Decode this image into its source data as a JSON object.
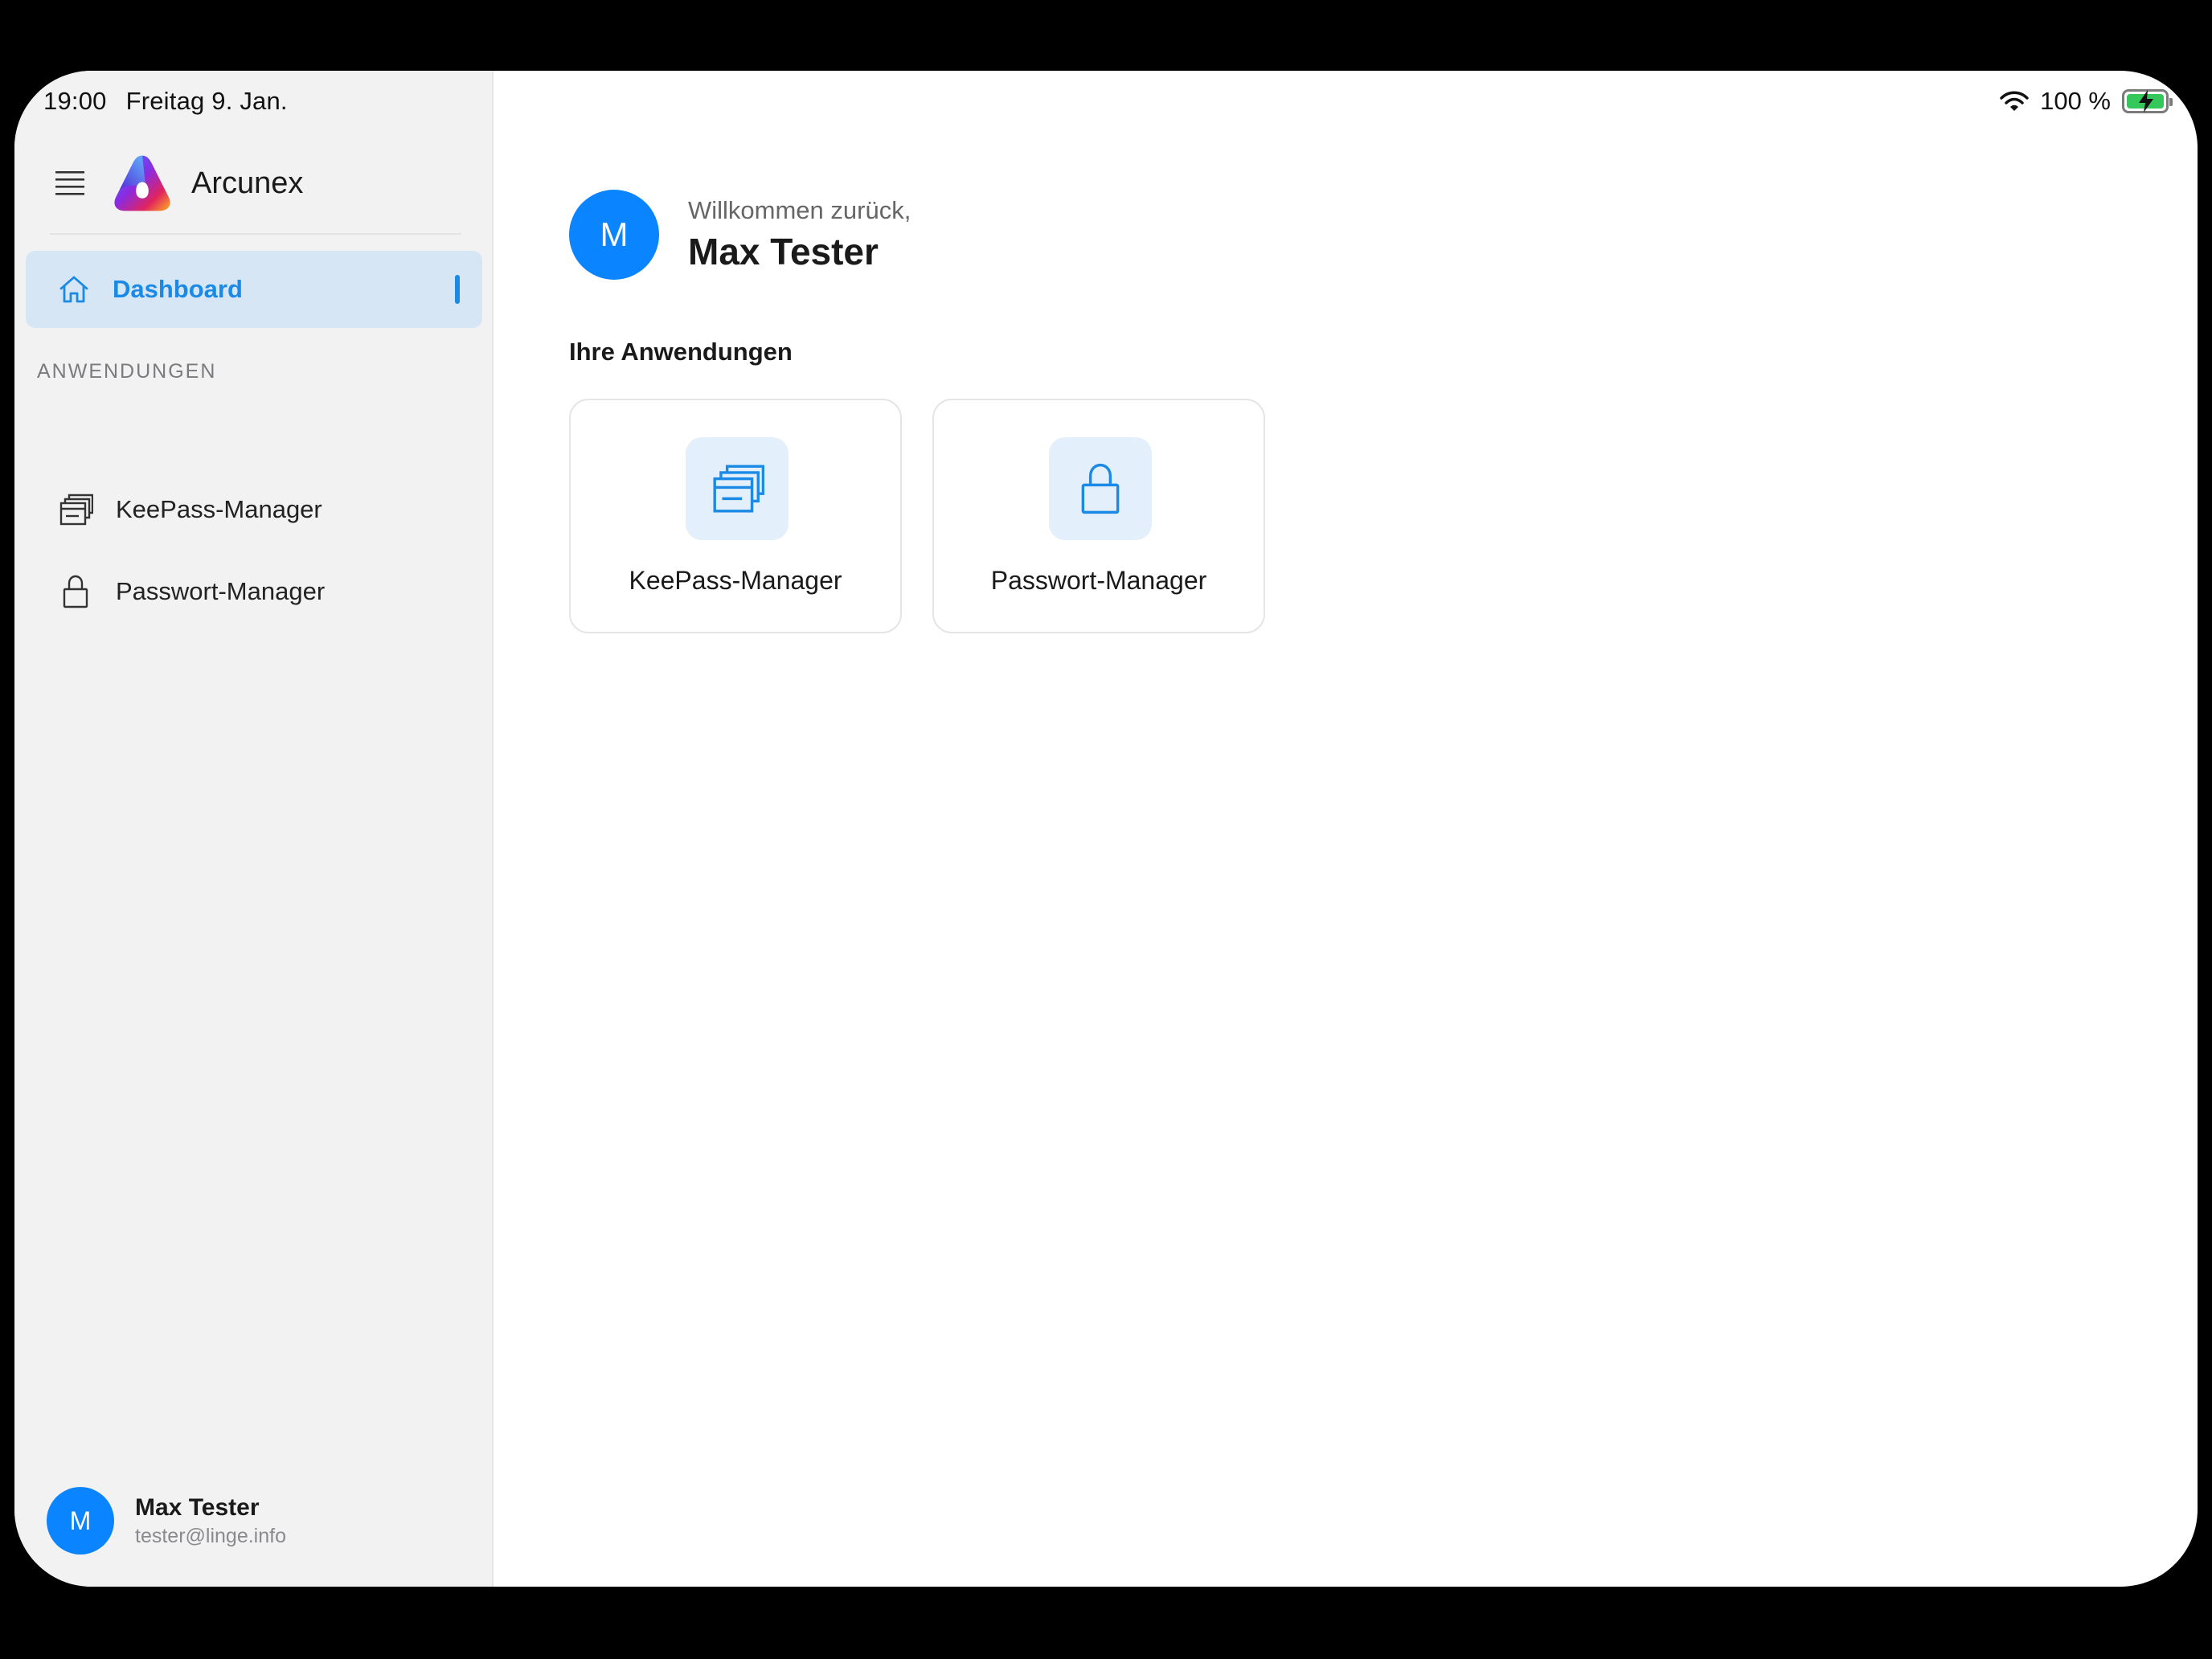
{
  "status_bar": {
    "time": "19:00",
    "date": "Freitag 9. Jan.",
    "battery_text": "100 %",
    "battery_level": 1.0
  },
  "sidebar": {
    "brand_name": "Arcunex",
    "nav": {
      "dashboard_label": "Dashboard"
    },
    "section_label": "ANWENDUNGEN",
    "items": [
      {
        "label": "KeePass-Manager",
        "icon": "stacked-windows-icon"
      },
      {
        "label": "Passwort-Manager",
        "icon": "lock-icon"
      }
    ],
    "user": {
      "initial": "M",
      "name": "Max Tester",
      "email": "tester@linge.info"
    }
  },
  "main": {
    "avatar_initial": "M",
    "welcome_sub": "Willkommen zurück,",
    "welcome_name": "Max Tester",
    "section_title": "Ihre Anwendungen",
    "apps": [
      {
        "label": "KeePass-Manager",
        "icon": "stacked-windows-icon"
      },
      {
        "label": "Passwort-Manager",
        "icon": "lock-icon"
      }
    ]
  },
  "colors": {
    "accent": "#0a84ff",
    "active_nav_bg": "#d6e6f5",
    "active_nav_text": "#1a8ae6",
    "sidebar_bg": "#f2f2f3",
    "icon_box_bg": "#e3effb",
    "battery_green": "#34c759"
  }
}
